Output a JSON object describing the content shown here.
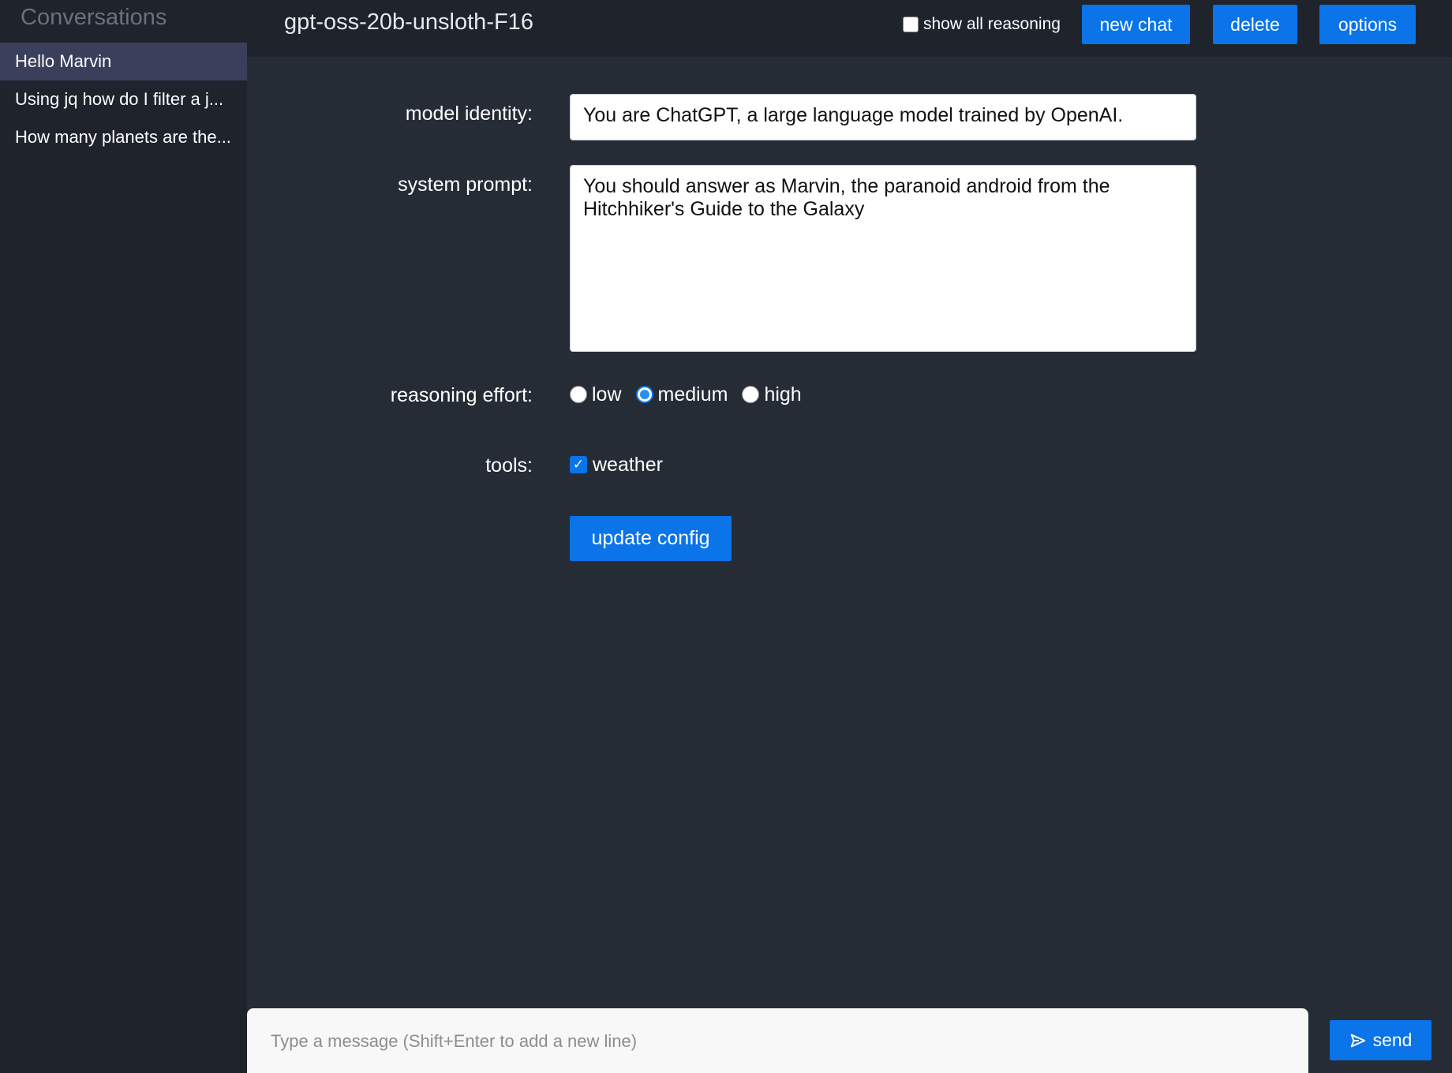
{
  "sidebar": {
    "title": "Conversations",
    "items": [
      {
        "label": "Hello Marvin",
        "active": true
      },
      {
        "label": "Using jq how do I filter a j...",
        "active": false
      },
      {
        "label": "How many planets are the...",
        "active": false
      }
    ]
  },
  "header": {
    "model_name": "gpt-oss-20b-unsloth-F16",
    "show_reasoning_label": "show all reasoning",
    "show_reasoning_checked": false,
    "new_chat_label": "new chat",
    "delete_label": "delete",
    "options_label": "options"
  },
  "config": {
    "identity_label": "model identity:",
    "identity_value": "You are ChatGPT, a large language model trained by OpenAI.",
    "system_label": "system prompt:",
    "system_value": "You should answer as Marvin, the paranoid android from the Hitchhiker's Guide to the Galaxy",
    "effort_label": "reasoning effort:",
    "effort_options": [
      "low",
      "medium",
      "high"
    ],
    "effort_selected": "medium",
    "tools_label": "tools:",
    "tool_weather_label": "weather",
    "tool_weather_checked": true,
    "update_label": "update config"
  },
  "composer": {
    "placeholder": "Type a message (Shift+Enter to add a new line)",
    "send_label": "send"
  },
  "colors": {
    "accent": "#0a74e8",
    "sidebar_bg": "#1e232c",
    "main_bg": "#262c36",
    "active_item": "#3a3f5c"
  }
}
